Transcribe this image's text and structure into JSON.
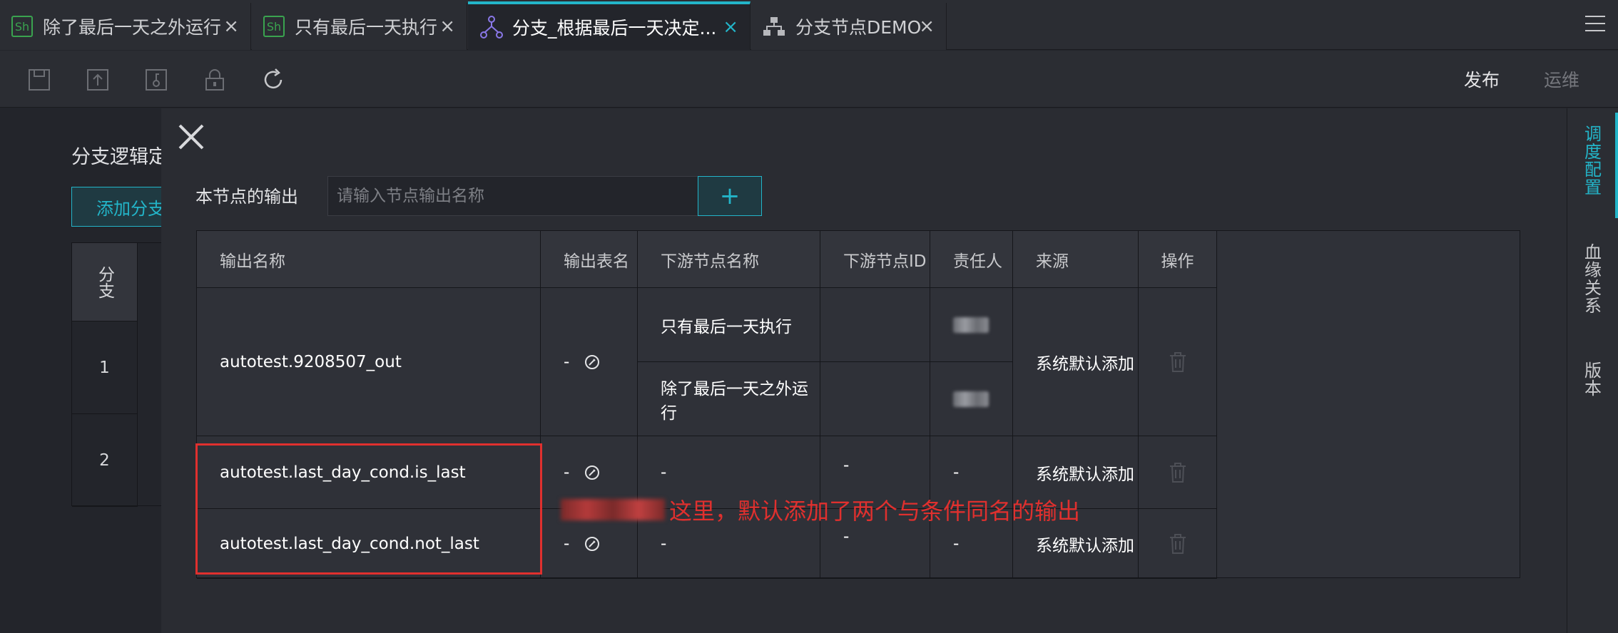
{
  "tabs": [
    {
      "label": "除了最后一天之外运行",
      "icon": "sh-icon",
      "icon_text": "Sh",
      "active": false
    },
    {
      "label": "只有最后一天执行",
      "icon": "sh-icon",
      "icon_text": "Sh",
      "active": false
    },
    {
      "label": "分支_根据最后一天决定...",
      "icon": "branch-icon",
      "active": true
    },
    {
      "label": "分支节点DEMO",
      "icon": "flow-icon",
      "active": false
    }
  ],
  "tab_close_glyph": "×",
  "toolbar": {
    "icons": [
      "save-icon",
      "submit-icon",
      "lock-icon",
      "unlock-icon",
      "refresh-icon"
    ],
    "publish_label": "发布",
    "ops_label": "运维"
  },
  "rail": {
    "items": [
      {
        "label": "调度配置",
        "active": true
      },
      {
        "label": "血缘关系",
        "active": false
      },
      {
        "label": "版本",
        "active": false
      }
    ]
  },
  "background": {
    "title": "分支逻辑定",
    "add_button": "添加分支",
    "header": "分支",
    "rows": [
      "1",
      "2"
    ]
  },
  "drawer": {
    "output_label": "本节点的输出",
    "output_placeholder": "请输入节点输出名称",
    "add_glyph": "+",
    "columns": [
      "输出名称",
      "输出表名",
      "下游节点名称",
      "下游节点ID",
      "责任人",
      "来源",
      "操作"
    ],
    "rows": [
      {
        "output_name": "autotest.9208507_out",
        "table_name": "-",
        "downstream": [
          {
            "name": "只有最后一天执行",
            "id": ""
          },
          {
            "name": "除了最后一天之外运行",
            "id": ""
          }
        ],
        "source": "系统默认添加"
      },
      {
        "output_name": "autotest.last_day_cond.is_last",
        "table_name": "-",
        "downstream": [
          {
            "name": "-",
            "id": "-"
          }
        ],
        "owner": "-",
        "source": "系统默认添加"
      },
      {
        "output_name": "autotest.last_day_cond.not_last",
        "table_name": "-",
        "downstream": [
          {
            "name": "-",
            "id": "-"
          }
        ],
        "owner": "-",
        "source": "系统默认添加"
      }
    ],
    "annotation": "这里，默认添加了两个与条件同名的输出"
  },
  "colors": {
    "accent": "#23b5c9",
    "annotation_red": "#e0302e",
    "background": "#23252b"
  }
}
